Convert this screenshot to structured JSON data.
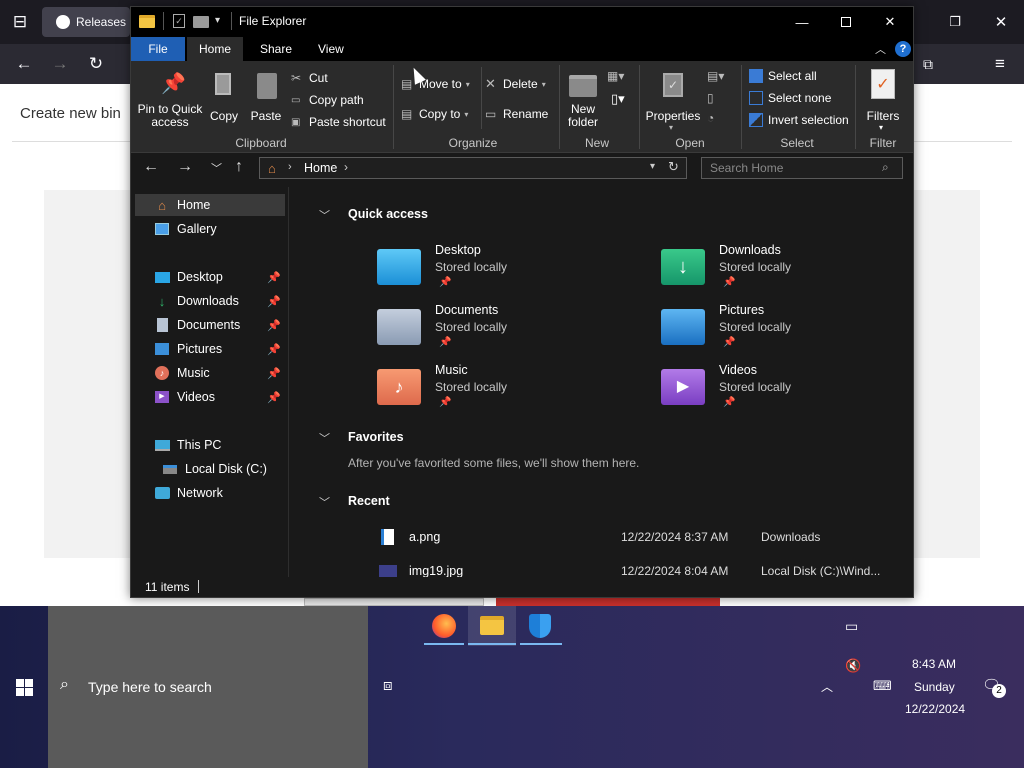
{
  "browser": {
    "tab_title": "Releases",
    "heading": "Create new bin"
  },
  "explorer": {
    "title": "File Explorer",
    "tabs": [
      "File",
      "Home",
      "Share",
      "View"
    ],
    "ribbon": {
      "pin_to_quick_access": "Pin to Quick access",
      "copy": "Copy",
      "paste": "Paste",
      "cut": "Cut",
      "copy_path": "Copy path",
      "paste_shortcut": "Paste shortcut",
      "move_to": "Move to",
      "copy_to": "Copy to",
      "delete": "Delete",
      "rename": "Rename",
      "new_folder": "New folder",
      "properties": "Properties",
      "select_all": "Select all",
      "select_none": "Select none",
      "invert_selection": "Invert selection",
      "filters": "Filters",
      "groups": {
        "clipboard": "Clipboard",
        "organize": "Organize",
        "new": "New",
        "open": "Open",
        "select": "Select",
        "filter": "Filter"
      }
    },
    "address": {
      "crumb": "Home",
      "search_placeholder": "Search Home"
    },
    "sidebar": {
      "home": "Home",
      "gallery": "Gallery",
      "desktop": "Desktop",
      "downloads": "Downloads",
      "documents": "Documents",
      "pictures": "Pictures",
      "music": "Music",
      "videos": "Videos",
      "this_pc": "This PC",
      "local_disk": "Local Disk (C:)",
      "network": "Network"
    },
    "main": {
      "quick_access": "Quick access",
      "favorites": "Favorites",
      "favorites_empty": "After you've favorited some files, we'll show them here.",
      "recent": "Recent",
      "folders": [
        {
          "name": "Desktop",
          "sub": "Stored locally"
        },
        {
          "name": "Downloads",
          "sub": "Stored locally"
        },
        {
          "name": "Documents",
          "sub": "Stored locally"
        },
        {
          "name": "Pictures",
          "sub": "Stored locally"
        },
        {
          "name": "Music",
          "sub": "Stored locally"
        },
        {
          "name": "Videos",
          "sub": "Stored locally"
        }
      ],
      "recent_files": [
        {
          "name": "a.png",
          "date": "12/22/2024 8:37 AM",
          "location": "Downloads"
        },
        {
          "name": "img19.jpg",
          "date": "12/22/2024 8:04 AM",
          "location": "Local Disk (C:)\\Wind..."
        }
      ]
    },
    "status": "11 items"
  },
  "taskbar": {
    "search_placeholder": "Type here to search",
    "time": "8:43 AM",
    "day": "Sunday",
    "date": "12/22/2024",
    "notification_count": "2"
  },
  "colors": {
    "accent": "#1f5fb4",
    "taskbar_search": "#5a5a5a"
  }
}
